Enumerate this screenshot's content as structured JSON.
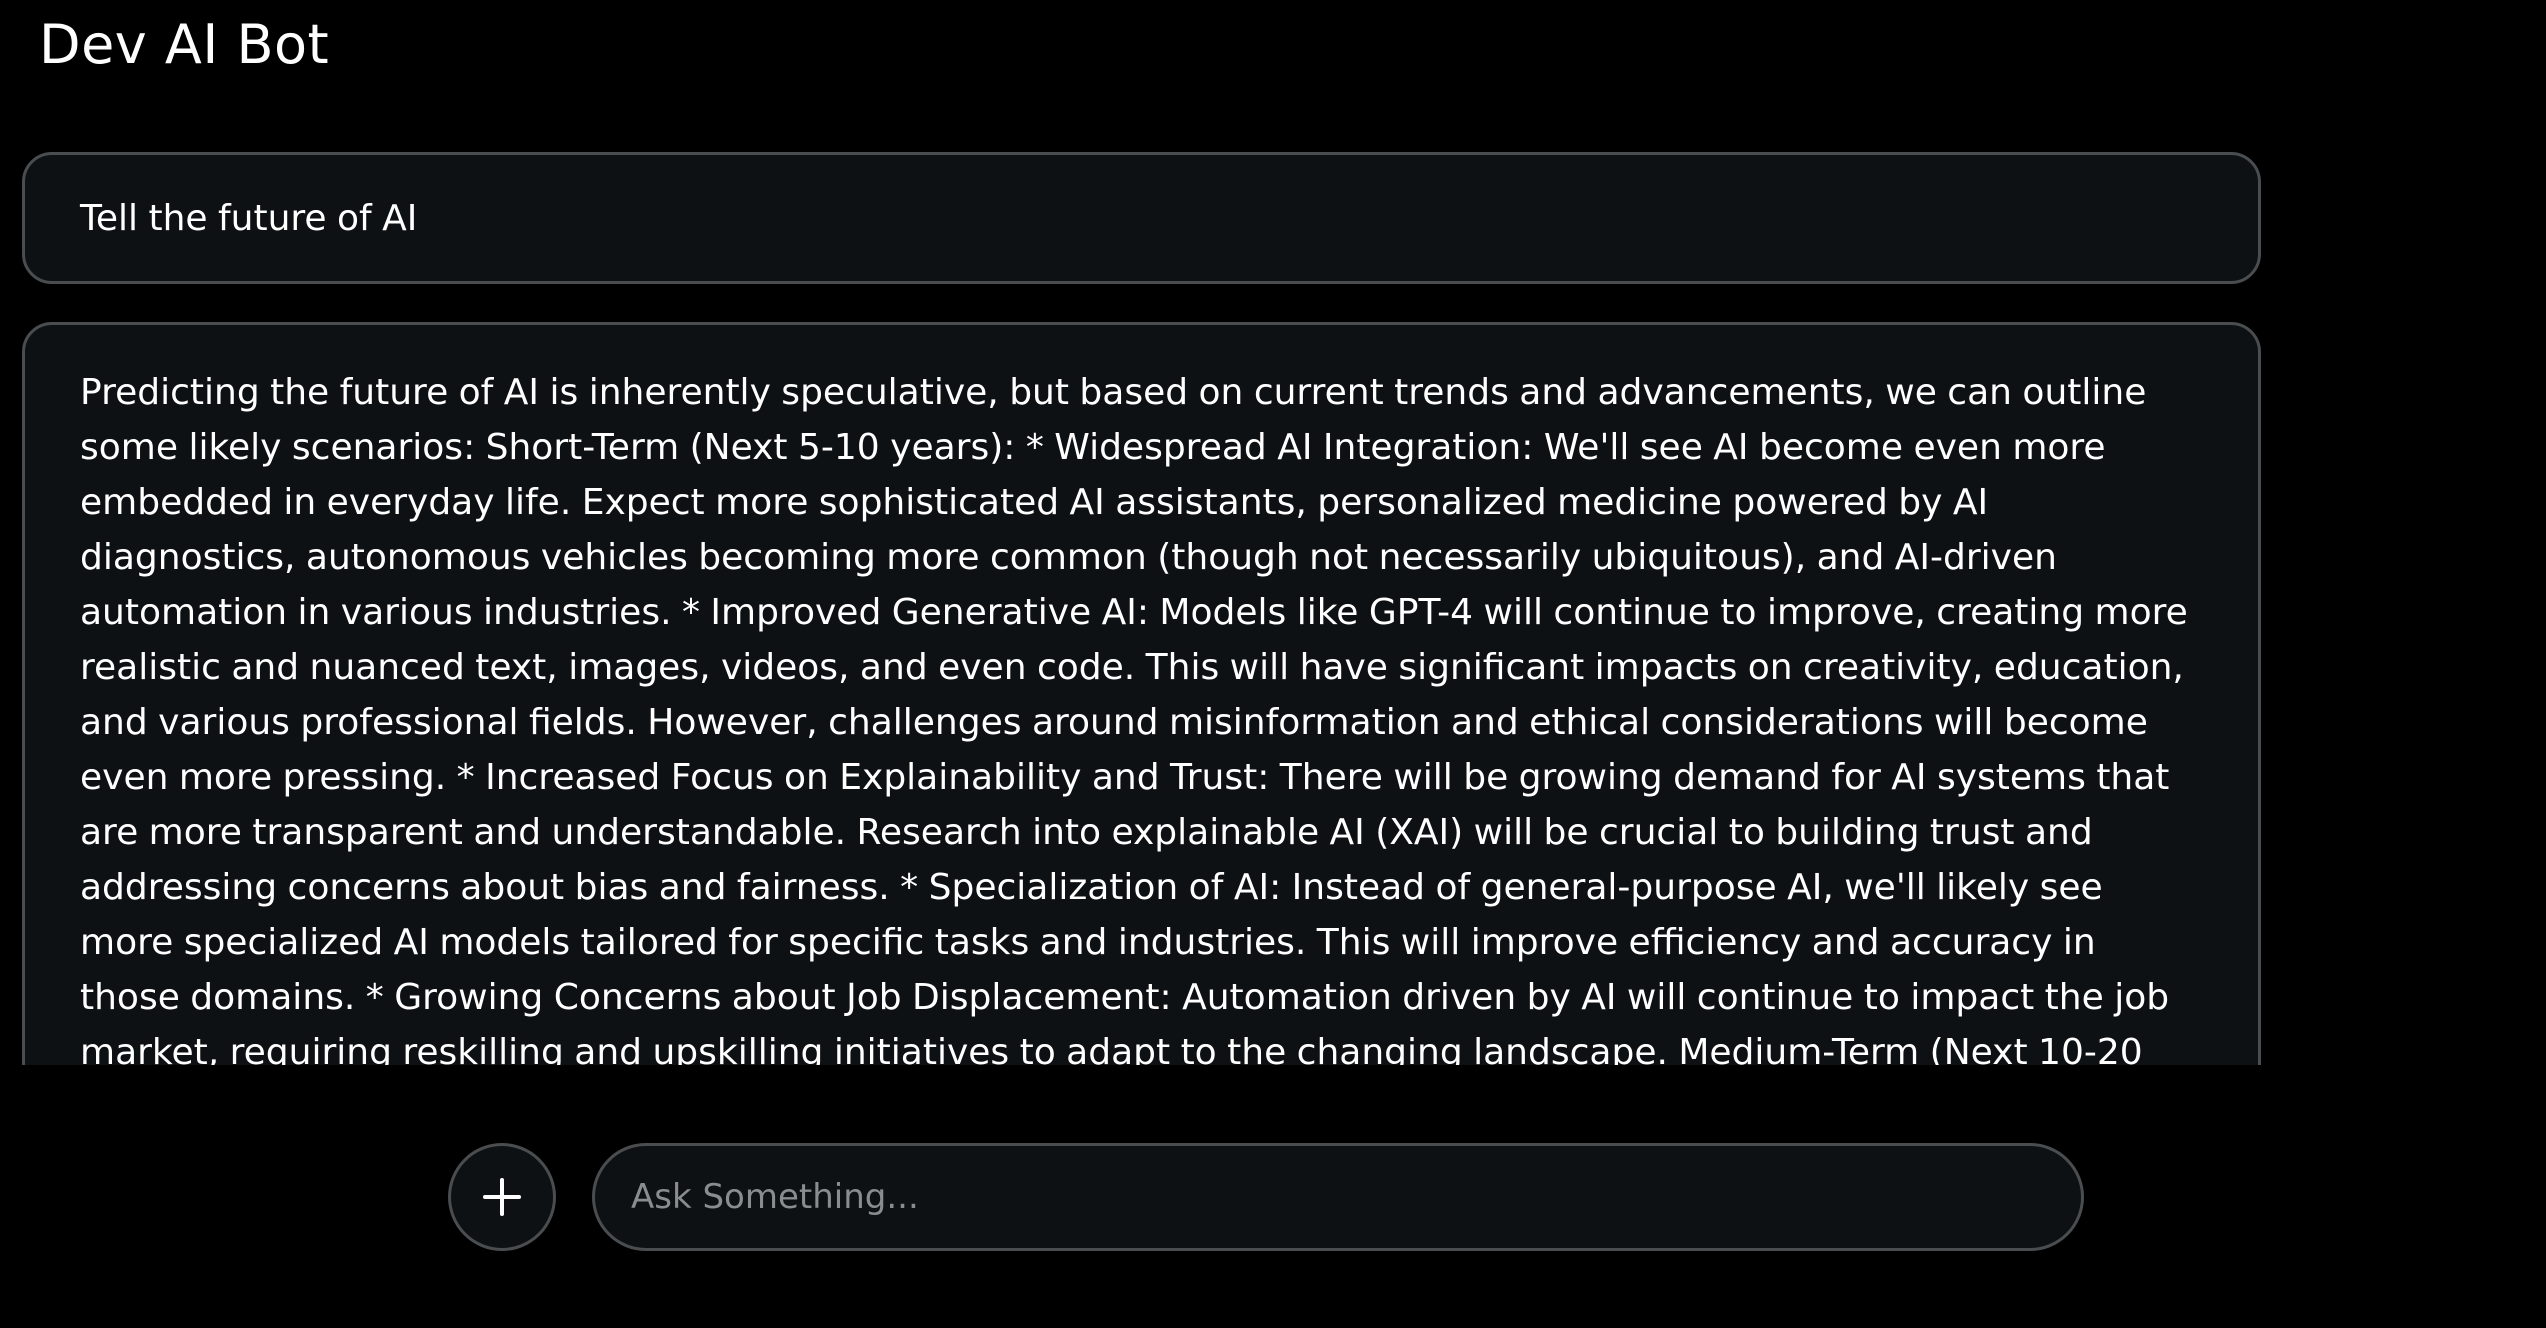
{
  "app": {
    "title": "Dev AI Bot"
  },
  "chat": {
    "messages": [
      {
        "role": "user",
        "text": "Tell the future of AI"
      },
      {
        "role": "bot",
        "text": "Predicting the future of AI is inherently speculative, but based on current trends and advancements, we can outline some likely scenarios: Short-Term (Next 5-10 years): * Widespread AI Integration: We'll see AI become even more embedded in everyday life. Expect more sophisticated AI assistants, personalized medicine powered by AI diagnostics, autonomous vehicles becoming more common (though not necessarily ubiquitous), and AI-driven automation in various industries. * Improved Generative AI: Models like GPT-4 will continue to improve, creating more realistic and nuanced text, images, videos, and even code. This will have significant impacts on creativity, education, and various professional fields. However, challenges around misinformation and ethical considerations will become even more pressing. * Increased Focus on Explainability and Trust: There will be growing demand for AI systems that are more transparent and understandable. Research into explainable AI (XAI) will be crucial to building trust and addressing concerns about bias and fairness. * Specialization of AI: Instead of general-purpose AI, we'll likely see more specialized AI models tailored for specific tasks and industries. This will improve efficiency and accuracy in those domains. * Growing Concerns about Job Displacement: Automation driven by AI will continue to impact the job market, requiring reskilling and upskilling initiatives to adapt to the changing landscape. Medium-Term (Next 10-20"
      }
    ]
  },
  "composer": {
    "add_icon": "plus-icon",
    "placeholder": "Ask Something..."
  },
  "colors": {
    "background": "#000000",
    "bubble_bg": "#0d1113",
    "border": "#4a4d4f",
    "text": "#ffffff",
    "placeholder": "#8a8d8f"
  }
}
